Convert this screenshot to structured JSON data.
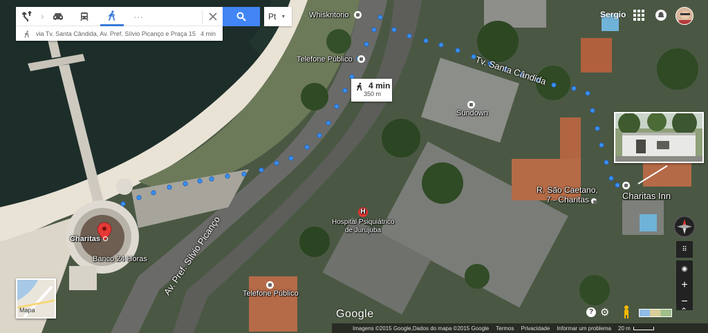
{
  "directions": {
    "mode_active": "walking",
    "route_via": "via Tv. Santa Cândida, Av. Pref. Sílvio Picanço e Praça 15",
    "route_time": "4 min"
  },
  "language": {
    "selected": "Pt"
  },
  "account": {
    "name": "Sergio"
  },
  "callout": {
    "time": "4 min",
    "distance": "350 m"
  },
  "labels": {
    "whiskritorio": "Whiskritorio",
    "telefone_top": "Telefone Público",
    "sundown": "Sundown",
    "tv_santa_candida": "Tv. Santa Cândida",
    "hospital_line1": "Hospital Psiquiátrico",
    "hospital_line2": "de Jurujuba",
    "rua_sao_caetano_line1": "R. São Caetano,",
    "rua_sao_caetano_line2": "7 - Charitas",
    "charitas_inn": "Charitas Inn",
    "charitas": "Charitas",
    "banco": "Banco 24 Horas",
    "av_pref": "Av. Pref. Sílvio Picanço",
    "telefone_bottom": "Telefone Público"
  },
  "maptype": {
    "label": "Mapa"
  },
  "footer": {
    "logo": "Google",
    "imagery": "Imagens ©2015 Google,Dados do mapa ©2015 Google",
    "terms": "Termos",
    "privacy": "Privacidade",
    "report": "Informar um problema",
    "scale": "20 m"
  },
  "colors": {
    "route_dot": "#3a8ff2",
    "accent_blue": "#4285f4",
    "pin_red": "#e53935"
  },
  "icons": [
    "directions-icon",
    "car-icon",
    "transit-icon",
    "walk-icon",
    "more-icon",
    "close-icon",
    "search-icon",
    "apps-icon",
    "notifications-icon",
    "compass-icon",
    "zoom-in-icon",
    "zoom-out-icon",
    "pegman-icon",
    "help-icon",
    "settings-icon"
  ]
}
